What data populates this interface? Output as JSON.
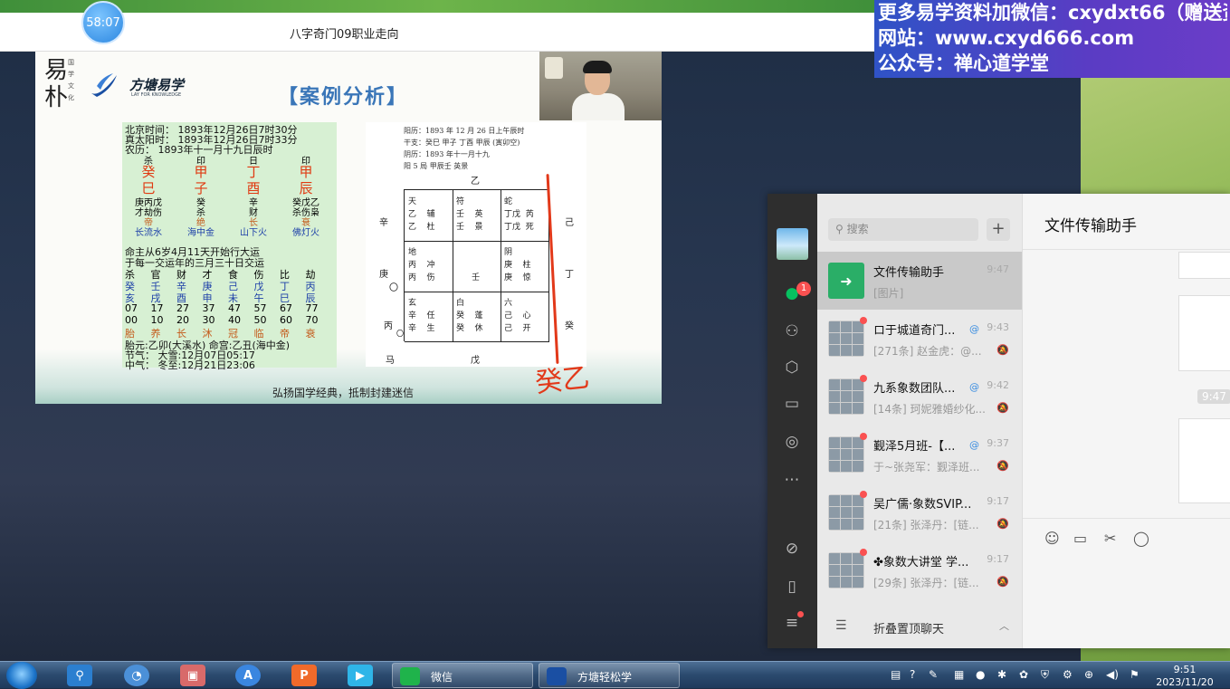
{
  "video_window": {
    "title": "八字奇门09职业走向",
    "timer": "58:07"
  },
  "promo": {
    "line1": "更多易学资料加微信：cxydxt66（赠送资",
    "line2": "网站：www.cxyd666.com",
    "line3": "公众号：禅心道学堂"
  },
  "slide": {
    "brand_char": "易\n朴",
    "brand_small": "国学文化",
    "logo_text": "方塘易学",
    "logo_sub": "LAY FOR KNOWLEDGE",
    "case_title": "【案例分析】",
    "footer": "弘扬国学经典，抵制封建迷信",
    "red_note": "癸乙",
    "bazi": {
      "line_beijing": "北京时间：  1893年12月26日7时30分",
      "line_solar": "真太阳时：  1893年12月26日7时33分",
      "line_lunar": "农历：  1893年十一月十九日辰时",
      "shishen_top": [
        "杀",
        "印",
        "日",
        "印"
      ],
      "stems": [
        "癸",
        "甲",
        "丁",
        "甲"
      ],
      "branches": [
        "巳",
        "子",
        "酉",
        "辰"
      ],
      "hidden": [
        "庚丙戊",
        "癸",
        "辛",
        "癸戊乙"
      ],
      "hidden_gods": [
        "才劫伤",
        "杀",
        "财",
        "杀伤枭"
      ],
      "stages": [
        "帝",
        "绝",
        "长",
        "衰"
      ],
      "nayin": [
        "长流水",
        "海中金",
        "山下火",
        "佛灯火"
      ],
      "dayun_start": "命主从6岁4月11天开始行大运",
      "dayun_change": "于每一交运年的三月三十日交运",
      "dayun_gods": [
        "杀",
        "官",
        "财",
        "才",
        "食",
        "伤",
        "比",
        "劫"
      ],
      "dayun_stems": [
        "癸",
        "壬",
        "辛",
        "庚",
        "己",
        "戊",
        "丁",
        "丙"
      ],
      "dayun_branches": [
        "亥",
        "戌",
        "酉",
        "申",
        "未",
        "午",
        "巳",
        "辰"
      ],
      "dayun_ages": [
        "07",
        "17",
        "27",
        "37",
        "47",
        "57",
        "67",
        "77"
      ],
      "dayun_years": [
        "00",
        "10",
        "20",
        "30",
        "40",
        "50",
        "60",
        "70"
      ],
      "dayun_stages": [
        "胎",
        "养",
        "长",
        "沐",
        "冠",
        "临",
        "帝",
        "衰"
      ],
      "taiyuan": "胎元:乙卯(大溪水) 命宫:乙丑(海中金)",
      "jieqi": "节气：  大雪:12月07日05:17",
      "zhongqi": "中气：  冬至:12月21日23:06"
    },
    "qimen": {
      "header1": "阳历：1893 年 12 月 26 日上午辰时",
      "header2": "干支：癸巳 甲子 丁酉 甲辰 (寅卯空)",
      "header3": "阴历：1893 年十一月十九",
      "header4": "阳 5 局  甲辰壬  英景",
      "top_mark": "乙",
      "bottom_left": "马",
      "bottom_mid": "戊",
      "left_labels": [
        "辛",
        "庚",
        "丙"
      ],
      "left_circles": [
        "〇",
        "〇"
      ],
      "right_labels": [
        "己",
        "丁",
        "癸"
      ],
      "cells": [
        "天\n乙    辅\n乙    杜",
        "符\n壬    英\n壬    景",
        "蛇\n丁戊  芮\n丁戊  死",
        "地\n丙    冲\n丙    伤",
        "\n\n      壬",
        "阴\n庚    柱\n庚    惊",
        "玄\n辛    任\n辛    生",
        "白\n癸    蓬\n癸    休",
        "六\n己    心\n己    开"
      ]
    }
  },
  "wechat": {
    "search_placeholder": "搜索",
    "plus": "+",
    "badge": "1",
    "chats": [
      {
        "name": "文件传输助手",
        "time": "9:47",
        "preview": "[图片]",
        "active": true
      },
      {
        "name": "ロ于城道奇门...",
        "time": "9:43",
        "preview": "[271条] 赵金虎：@..."
      },
      {
        "name": "九系象数团队...",
        "time": "9:42",
        "preview": "[14条] 珂妮雅婚纱化..."
      },
      {
        "name": "觐泽5月班-【...",
        "time": "9:37",
        "preview": "于~张尧军：觐泽班..."
      },
      {
        "name": "吴广儒·象数SVIP...",
        "time": "9:17",
        "preview": "[21条] 张泽丹：[链..."
      },
      {
        "name": "✤象数大讲堂 学...",
        "time": "9:17",
        "preview": "[29条] 张泽丹：[链..."
      }
    ],
    "fold_label": "折叠置顶聊天",
    "chat_title": "文件传输助手",
    "msg_time": "9:47"
  },
  "taskbar": {
    "apps": [
      {
        "label": "微信"
      },
      {
        "label": "方塘轻松学"
      }
    ],
    "time": "9:51",
    "date": "2023/11/20"
  }
}
